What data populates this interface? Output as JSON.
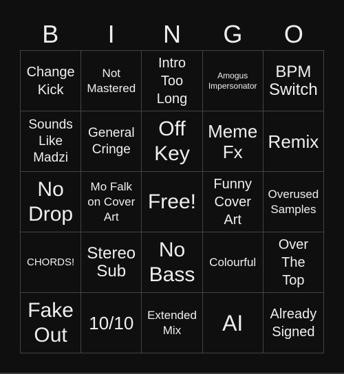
{
  "header": {
    "letters": [
      "B",
      "I",
      "N",
      "G",
      "O"
    ]
  },
  "cells": [
    "Change\nKick",
    "Not\nMastered",
    "Intro\nToo\nLong",
    "Amogus\nImpersonator",
    "BPM\nSwitch",
    "Sounds\nLike\nMadzi",
    "General\nCringe",
    "Off\nKey",
    "Meme\nFx",
    "Remix",
    "No\nDrop",
    "Mo Falk\non Cover\nArt",
    "Free!",
    "Funny\nCover\nArt",
    "Overused\nSamples",
    "CHORDS!",
    "Stereo\nSub",
    "No\nBass",
    "Colourful",
    "Over\nThe\nTop",
    "Fake\nOut",
    "10/10",
    "Extended\nMix",
    "AI",
    "Already\nSigned"
  ]
}
